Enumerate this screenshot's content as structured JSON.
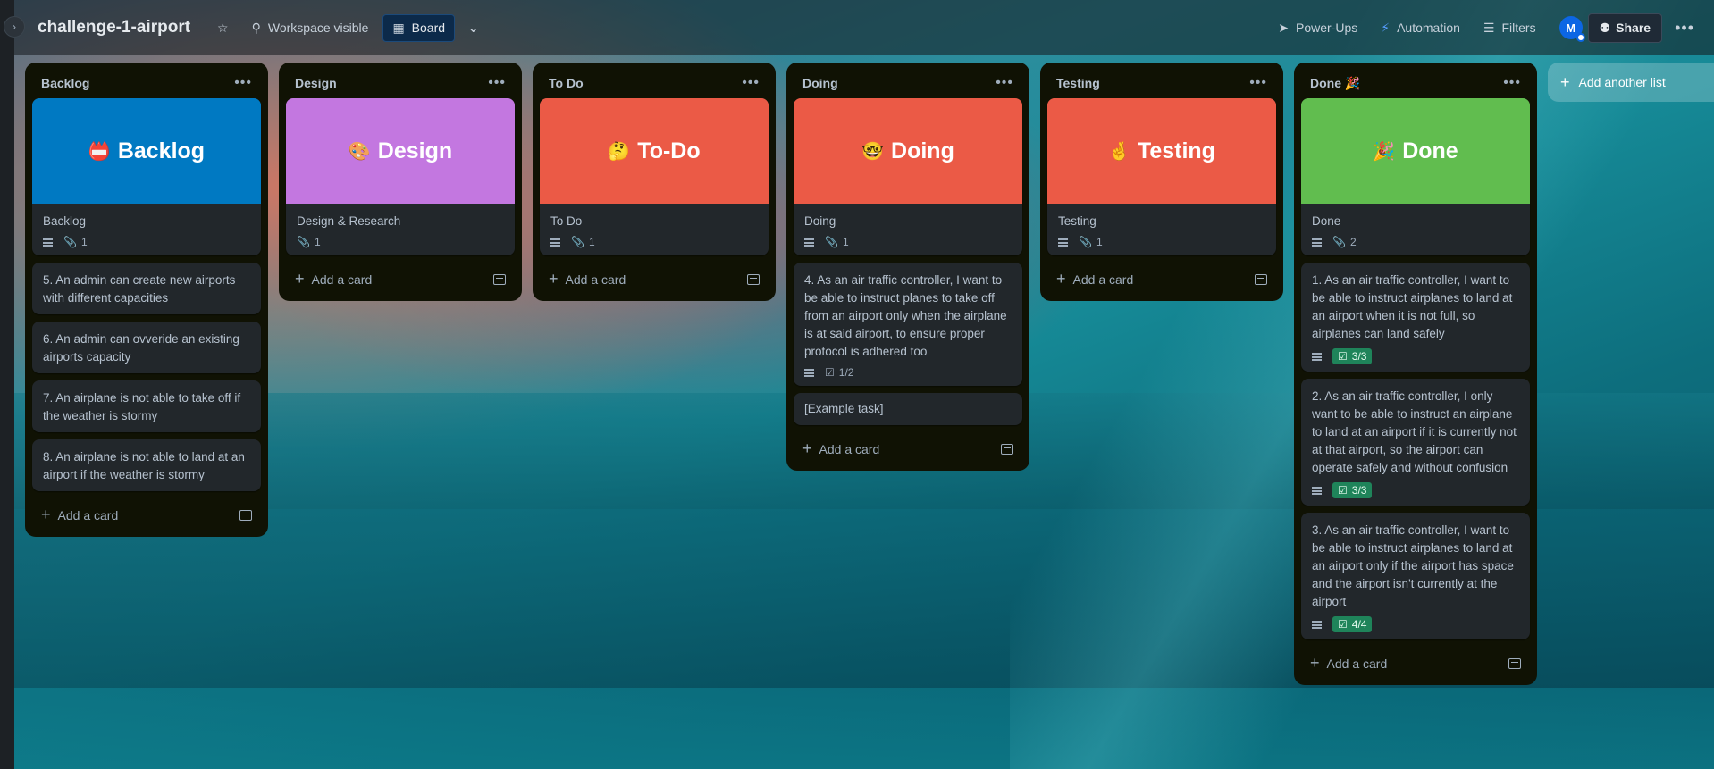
{
  "header": {
    "board_title": "challenge-1-airport",
    "visibility": "Workspace visible",
    "view": "Board",
    "power_ups": "Power-Ups",
    "automation": "Automation",
    "filters": "Filters",
    "avatar": "M",
    "share": "Share",
    "more": "•••"
  },
  "add_another_list": "Add another list",
  "add_card_label": "Add a card",
  "lists": {
    "backlog": {
      "title": "Backlog",
      "cover_emoji": "📛",
      "cover_text": "Backlog",
      "cover_color": "#0079c2",
      "card_title": "Backlog",
      "attachments": "1",
      "cards": [
        "5. An admin can create new airports with different capacities",
        "6. An admin can ovveride an existing airports capacity",
        "7. An airplane is not able to take off if the weather is stormy",
        "8. An airplane is not able to land at an airport if the weather is stormy"
      ]
    },
    "design": {
      "title": "Design",
      "cover_emoji": "🎨",
      "cover_text": "Design",
      "cover_color": "#c377e0",
      "card_title": "Design & Research",
      "attachments": "1"
    },
    "todo": {
      "title": "To Do",
      "cover_emoji": "🤔",
      "cover_text": "To-Do",
      "cover_color": "#eb5a46",
      "card_title": "To Do",
      "attachments": "1"
    },
    "doing": {
      "title": "Doing",
      "cover_emoji": "🤓",
      "cover_text": "Doing",
      "cover_color": "#eb5a46",
      "card_title": "Doing",
      "attachments": "1",
      "story": "4. As an air traffic controller, I want to be able to instruct planes to take off from an airport only when the airplane is at said airport, to ensure proper protocol is adhered too",
      "story_checklist": "1/2",
      "example": "[Example task]"
    },
    "testing": {
      "title": "Testing",
      "cover_emoji": "🤞",
      "cover_text": "Testing",
      "cover_color": "#eb5a46",
      "card_title": "Testing",
      "attachments": "1"
    },
    "done": {
      "title": "Done 🎉",
      "cover_emoji": "🎉",
      "cover_text": "Done",
      "cover_color": "#61bd4f",
      "card_title": "Done",
      "attachments": "2",
      "cards": [
        {
          "title": "1. As an air traffic controller, I want to be able to instruct airplanes to land at an airport when it is not full, so airplanes can land safely",
          "checklist": "3/3"
        },
        {
          "title": "2. As an air traffic controller, I only want to be able to instruct an airplane to land at an airport if it is currently not at that airport, so the airport can operate safely and without confusion",
          "checklist": "3/3"
        },
        {
          "title": "3. As an air traffic controller, I want to be able to instruct airplanes to land at an airport only if the airport has space and the airport isn't currently at the airport",
          "checklist": "4/4"
        }
      ]
    }
  }
}
